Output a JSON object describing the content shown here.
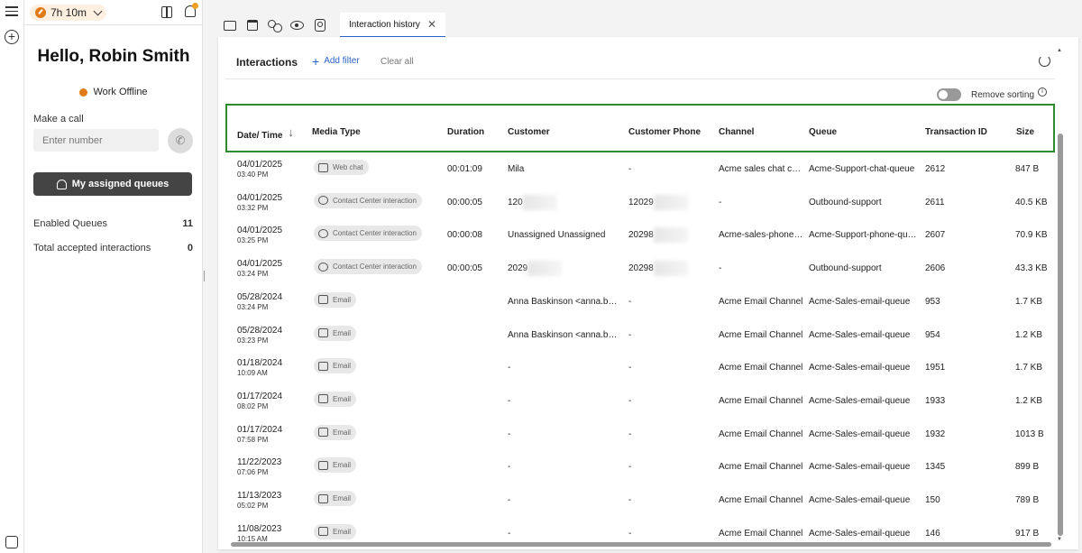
{
  "topbar": {
    "timer": "7h 10m"
  },
  "greeting": "Hello, Robin Smith",
  "agent_status": "Work Offline",
  "make_call": {
    "label": "Make a call",
    "placeholder": "Enter number"
  },
  "queues_button": "My assigned queues",
  "stats": [
    {
      "label": "Enabled Queues",
      "value": "11"
    },
    {
      "label": "Total accepted interactions",
      "value": "0"
    }
  ],
  "tab": {
    "label": "Interaction history",
    "close": "✕"
  },
  "card": {
    "title": "Interactions",
    "add_filter": "Add filter",
    "clear_all": "Clear all",
    "remove_sorting": "Remove sorting"
  },
  "columns": {
    "datetime": "Date/ Time",
    "media": "Media Type",
    "duration": "Duration",
    "customer": "Customer",
    "phone": "Customer Phone",
    "channel": "Channel",
    "queue": "Queue",
    "txid": "Transaction ID",
    "size": "Size"
  },
  "rows": [
    {
      "date": "04/01/2025",
      "time": "03:40 PM",
      "media": "Web chat",
      "media_icon": "chat-icon",
      "duration": "00:01:09",
      "customer": "Mila",
      "phone": "-",
      "channel": "Acme sales chat cha...",
      "queue": "Acme-Support-chat-queue",
      "txid": "2612",
      "size": "847 B"
    },
    {
      "date": "04/01/2025",
      "time": "03:32 PM",
      "media": "Contact Center interaction",
      "media_icon": "contact-center-icon",
      "duration": "00:00:05",
      "customer": "120",
      "phone": "12029",
      "channel": "-",
      "queue": "Outbound-support",
      "txid": "2611",
      "size": "40.5 KB"
    },
    {
      "date": "04/01/2025",
      "time": "03:25 PM",
      "media": "Contact Center interaction",
      "media_icon": "contact-center-icon",
      "duration": "00:00:08",
      "customer": "Unassigned Unassigned",
      "phone": "20298",
      "channel": "Acme-sales-phone-c...",
      "queue": "Acme-Support-phone-queue",
      "txid": "2607",
      "size": "70.9 KB"
    },
    {
      "date": "04/01/2025",
      "time": "03:24 PM",
      "media": "Contact Center interaction",
      "media_icon": "contact-center-icon",
      "duration": "00:00:05",
      "customer": "2029",
      "phone": "20298",
      "channel": "-",
      "queue": "Outbound-support",
      "txid": "2606",
      "size": "43.3 KB"
    },
    {
      "date": "05/28/2024",
      "time": "03:24 PM",
      "media": "Email",
      "media_icon": "email-icon",
      "duration": "",
      "customer": "Anna Baskinson <anna.bask...",
      "phone": "-",
      "channel": "Acme Email Channel",
      "queue": "Acme-Sales-email-queue",
      "txid": "953",
      "size": "1.7 KB"
    },
    {
      "date": "05/28/2024",
      "time": "03:23 PM",
      "media": "Email",
      "media_icon": "email-icon",
      "duration": "",
      "customer": "Anna Baskinson <anna.bask...",
      "phone": "-",
      "channel": "Acme Email Channel",
      "queue": "Acme-Sales-email-queue",
      "txid": "954",
      "size": "1.2 KB"
    },
    {
      "date": "01/18/2024",
      "time": "10:09 AM",
      "media": "Email",
      "media_icon": "email-icon",
      "duration": "",
      "customer": "-",
      "phone": "-",
      "channel": "Acme Email Channel",
      "queue": "Acme-Sales-email-queue",
      "txid": "1951",
      "size": "1.7 KB"
    },
    {
      "date": "01/17/2024",
      "time": "08:02 PM",
      "media": "Email",
      "media_icon": "email-icon",
      "duration": "",
      "customer": "-",
      "phone": "-",
      "channel": "Acme Email Channel",
      "queue": "Acme-Sales-email-queue",
      "txid": "1933",
      "size": "1.2 KB"
    },
    {
      "date": "01/17/2024",
      "time": "07:58 PM",
      "media": "Email",
      "media_icon": "email-icon",
      "duration": "",
      "customer": "-",
      "phone": "-",
      "channel": "Acme Email Channel",
      "queue": "Acme-Sales-email-queue",
      "txid": "1932",
      "size": "1013 B"
    },
    {
      "date": "11/22/2023",
      "time": "07:06 PM",
      "media": "Email",
      "media_icon": "email-icon",
      "duration": "",
      "customer": "-",
      "phone": "-",
      "channel": "Acme Email Channel",
      "queue": "Acme-Sales-email-queue",
      "txid": "1345",
      "size": "899 B"
    },
    {
      "date": "11/13/2023",
      "time": "05:02 PM",
      "media": "Email",
      "media_icon": "email-icon",
      "duration": "",
      "customer": "-",
      "phone": "-",
      "channel": "Acme Email Channel",
      "queue": "Acme-Sales-email-queue",
      "txid": "150",
      "size": "789 B"
    },
    {
      "date": "11/08/2023",
      "time": "10:15 AM",
      "media": "Email",
      "media_icon": "email-icon",
      "duration": "",
      "customer": "-",
      "phone": "-",
      "channel": "Acme Email Channel",
      "queue": "Acme-Sales-email-queue",
      "txid": "146",
      "size": "917 B"
    }
  ],
  "colors": {
    "accent": "#2b63c9",
    "status_orange": "#e07b18",
    "highlight_border": "#2d8a2d",
    "button_dark": "#444444"
  }
}
